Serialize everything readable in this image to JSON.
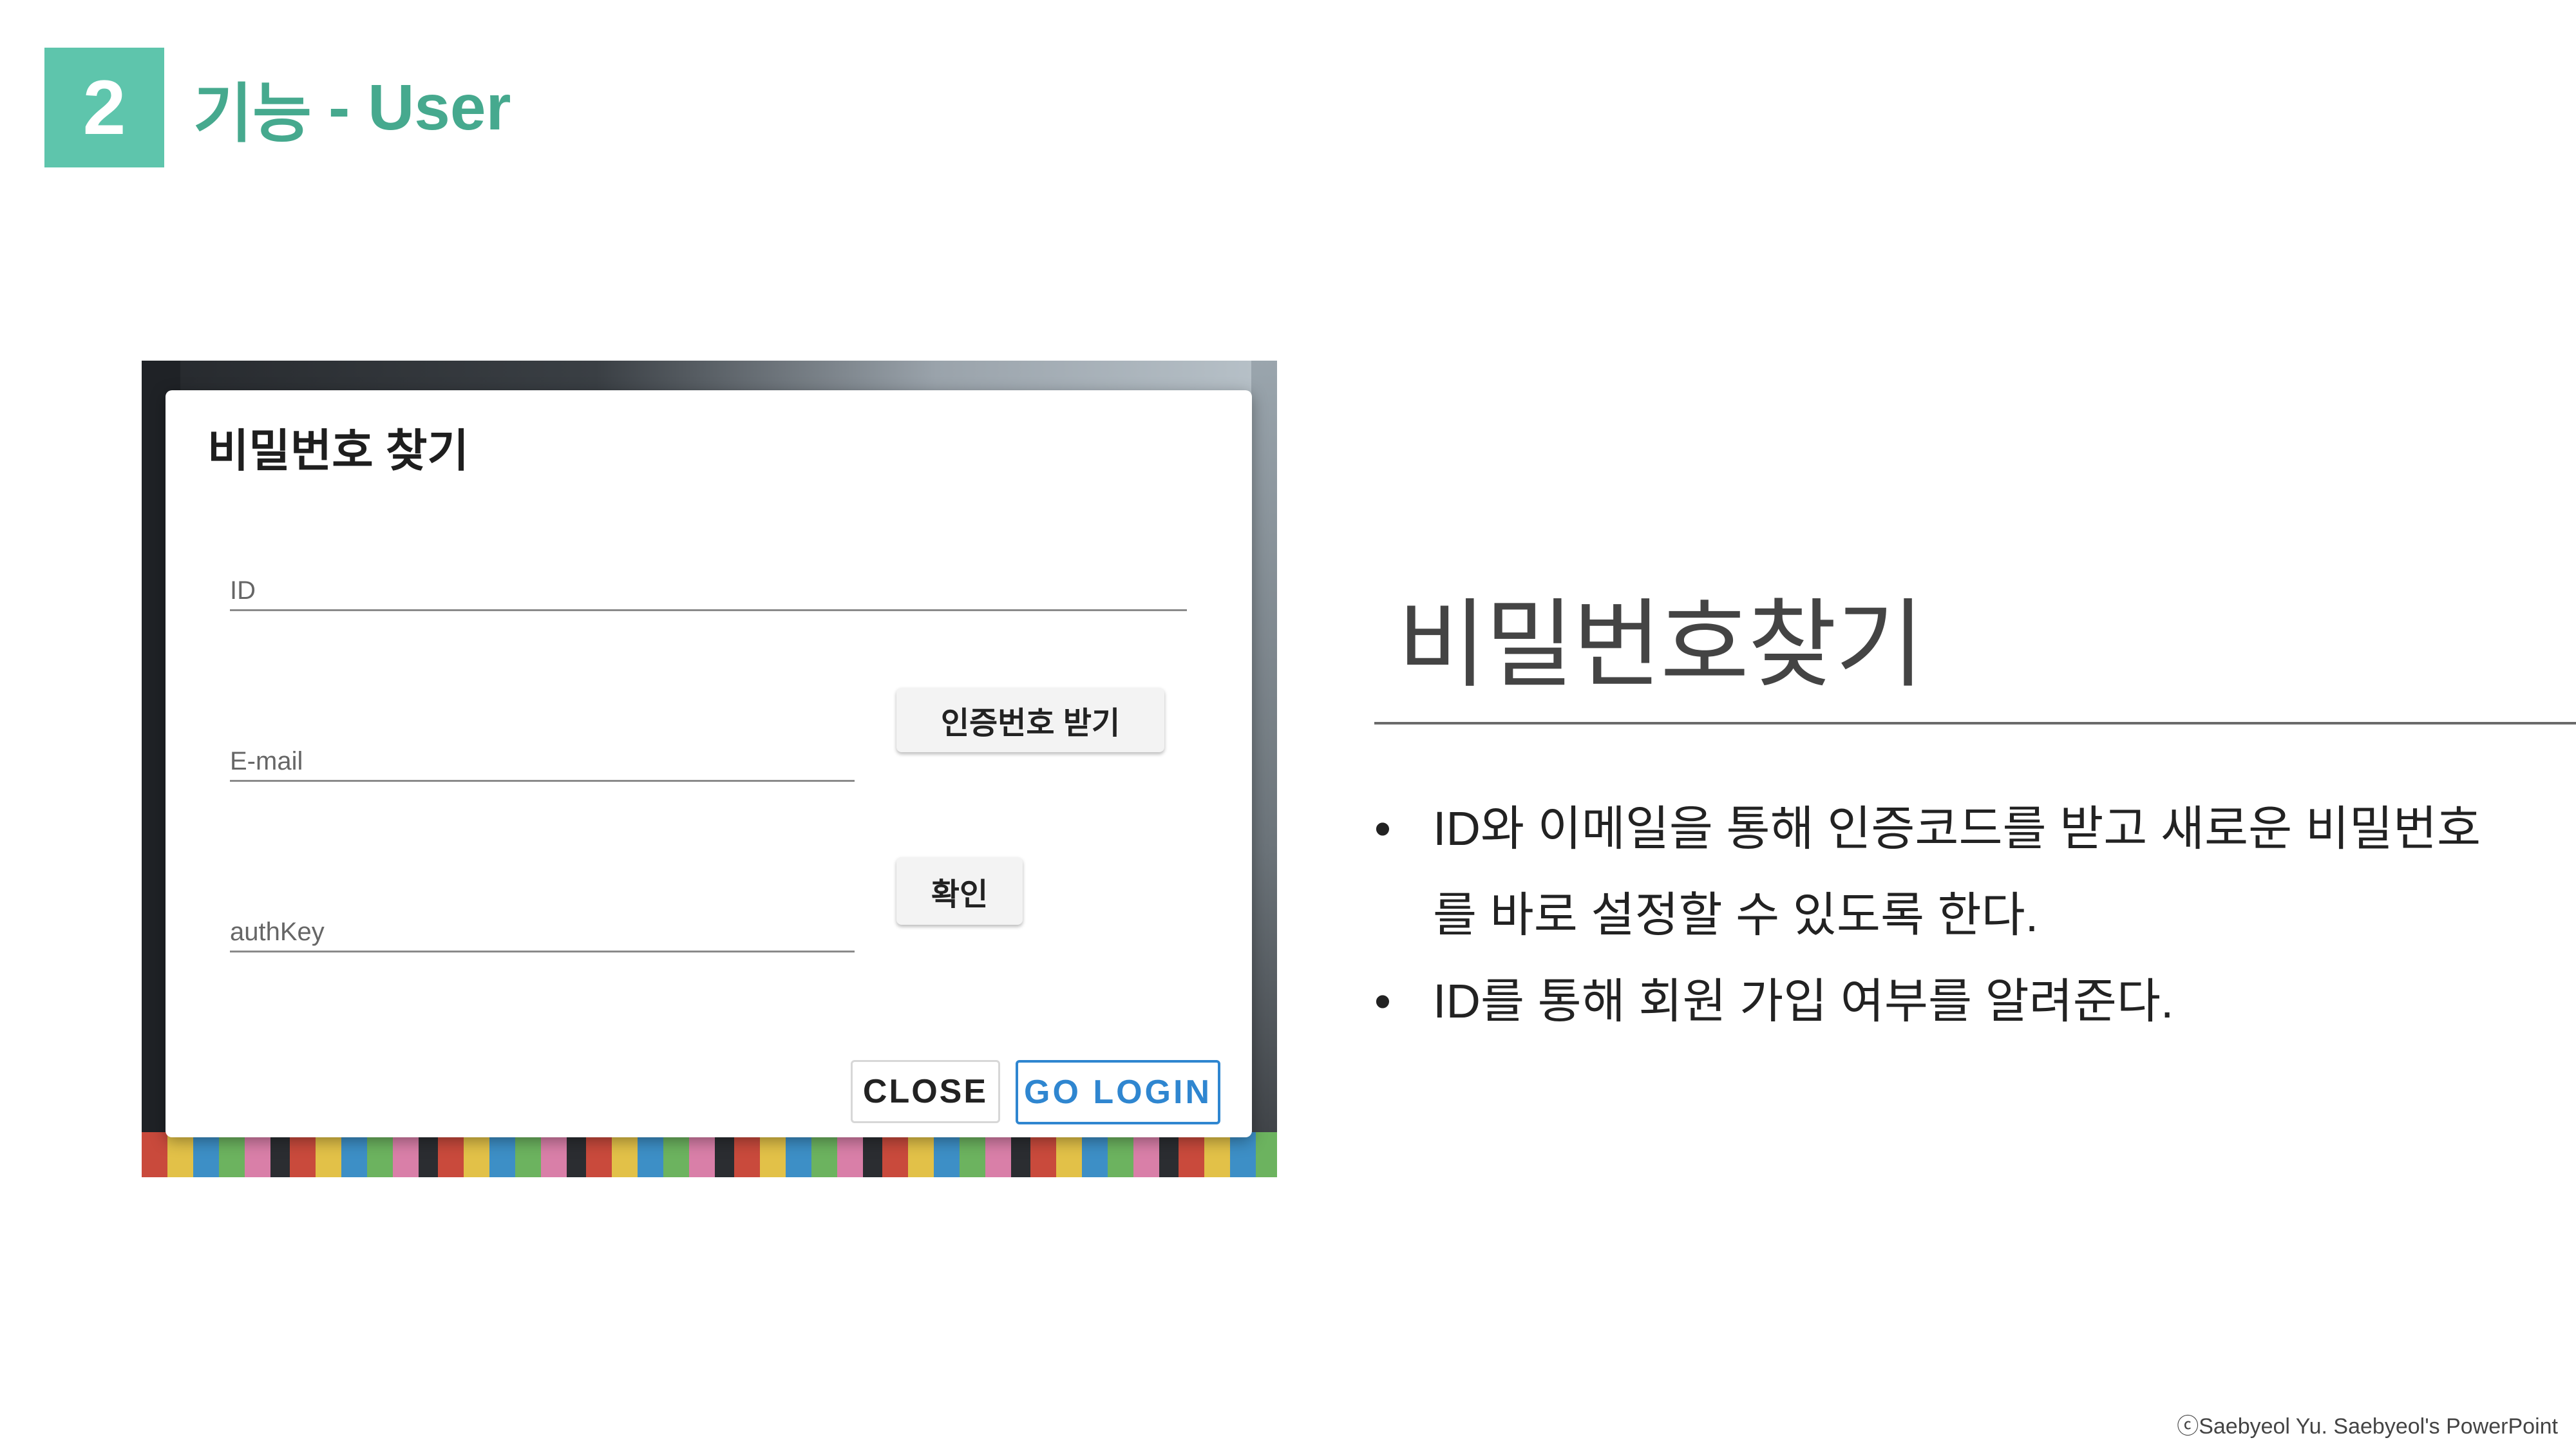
{
  "slide": {
    "number": "2",
    "title_main": "기능",
    "title_suffix": "- User"
  },
  "dialog": {
    "title": "비밀번호 찾기",
    "fields": {
      "id_placeholder": "ID",
      "email_placeholder": "E-mail",
      "authkey_placeholder": "authKey"
    },
    "buttons": {
      "request_code": "인증번호 받기",
      "confirm": "확인",
      "close": "CLOSE",
      "go_login": "GO LOGIN"
    }
  },
  "section": {
    "heading": "비밀번호찾기",
    "bullets": [
      "ID와 이메일을 통해 인증코드를 받고 새로운 비밀번호를 바로 설정할 수 있도록 한다.",
      "ID를 통해 회원 가입 여부를 알려준다."
    ],
    "bullet_symbol": "•"
  },
  "footer": {
    "copyright": "ⓒSaebyeol Yu. Saebyeol's PowerPoint"
  },
  "colors": {
    "accent": "#5ec5ac",
    "title": "#46a98e",
    "login_button": "#2f86d0"
  }
}
